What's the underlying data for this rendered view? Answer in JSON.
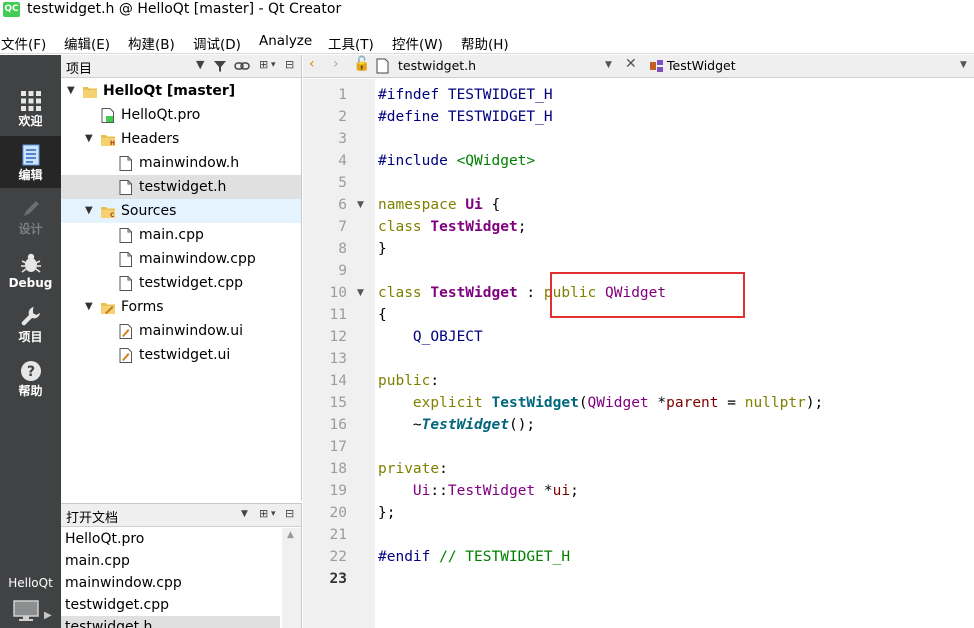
{
  "window": {
    "app_icon_text": "QC",
    "title": "testwidget.h @ HelloQt [master] - Qt Creator"
  },
  "menu": [
    "文件(F)",
    "编辑(E)",
    "构建(B)",
    "调试(D)",
    "Analyze",
    "工具(T)",
    "控件(W)",
    "帮助(H)"
  ],
  "modes": [
    {
      "label": "欢迎",
      "icon": "grid-icon"
    },
    {
      "label": "编辑",
      "icon": "edit-document-icon",
      "active": true
    },
    {
      "label": "设计",
      "icon": "pencil-icon",
      "disabled": true
    },
    {
      "label": "Debug",
      "icon": "bug-icon"
    },
    {
      "label": "项目",
      "icon": "wrench-icon"
    },
    {
      "label": "帮助",
      "icon": "help-icon"
    }
  ],
  "kit": {
    "label": "HelloQt",
    "icon": "monitor-icon"
  },
  "project_pane": {
    "title": "项目",
    "tree": [
      {
        "label": "HelloQt [master]",
        "bold": true,
        "arrow": "▼",
        "icon": "project-folder-icon"
      },
      {
        "label": "HelloQt.pro",
        "icon": "pro-file-icon"
      },
      {
        "label": "Headers",
        "arrow": "▼",
        "icon": "headers-folder-icon"
      },
      {
        "label": "mainwindow.h",
        "icon": "file-icon"
      },
      {
        "label": "testwidget.h",
        "icon": "file-icon",
        "selected": true
      },
      {
        "label": "Sources",
        "arrow": "▼",
        "icon": "sources-folder-icon",
        "hover": true
      },
      {
        "label": "main.cpp",
        "icon": "file-icon"
      },
      {
        "label": "mainwindow.cpp",
        "icon": "file-icon"
      },
      {
        "label": "testwidget.cpp",
        "icon": "file-icon"
      },
      {
        "label": "Forms",
        "arrow": "▼",
        "icon": "forms-folder-icon"
      },
      {
        "label": "mainwindow.ui",
        "icon": "ui-file-icon"
      },
      {
        "label": "testwidget.ui",
        "icon": "ui-file-icon"
      }
    ]
  },
  "docs_pane": {
    "title": "打开文档",
    "items": [
      "HelloQt.pro",
      "main.cpp",
      "mainwindow.cpp",
      "testwidget.cpp",
      "testwidget.h"
    ],
    "selected": "testwidget.h"
  },
  "editor": {
    "file_name": "testwidget.h",
    "symbol": "TestWidget",
    "current_line": 23,
    "fold_lines": [
      6,
      10
    ],
    "highlight_color": "#e03030",
    "lines": [
      [
        [
          "#ifndef TESTWIDGET_H",
          "pp"
        ]
      ],
      [
        [
          "#define TESTWIDGET_H",
          "pp"
        ]
      ],
      [],
      [
        [
          "#include ",
          "pp"
        ],
        [
          "<QWidget>",
          "st"
        ]
      ],
      [],
      [
        [
          "namespace ",
          "kw"
        ],
        [
          "Ui",
          "ty"
        ],
        [
          " {",
          "pl"
        ]
      ],
      [
        [
          "class ",
          "kw"
        ],
        [
          "TestWidget",
          "ty"
        ],
        [
          ";",
          "pl"
        ]
      ],
      [
        [
          "}",
          "pl"
        ]
      ],
      [],
      [
        [
          "class ",
          "kw"
        ],
        [
          "TestWidget",
          "ty"
        ],
        [
          " : ",
          "pl"
        ],
        [
          "public ",
          "kw"
        ],
        [
          "QWidget",
          "cl"
        ]
      ],
      [
        [
          "{",
          "pl"
        ]
      ],
      [
        [
          "    ",
          "pl"
        ],
        [
          "Q_OBJECT",
          "mc"
        ]
      ],
      [],
      [
        [
          "public",
          "kw"
        ],
        [
          ":",
          "pl"
        ]
      ],
      [
        [
          "    ",
          "pl"
        ],
        [
          "explicit ",
          "kw"
        ],
        [
          "TestWidget",
          "fn"
        ],
        [
          "(",
          "pl"
        ],
        [
          "QWidget",
          "cl"
        ],
        [
          " *",
          "pl"
        ],
        [
          "parent",
          "mb"
        ],
        [
          " = ",
          "pl"
        ],
        [
          "nullptr",
          "kw"
        ],
        [
          ");",
          "pl"
        ]
      ],
      [
        [
          "    ~",
          "pl"
        ],
        [
          "TestWidget",
          "fi"
        ],
        [
          "();",
          "pl"
        ]
      ],
      [],
      [
        [
          "private",
          "kw"
        ],
        [
          ":",
          "pl"
        ]
      ],
      [
        [
          "    ",
          "pl"
        ],
        [
          "Ui",
          "cl"
        ],
        [
          "::",
          "pl"
        ],
        [
          "TestWidget",
          "cl"
        ],
        [
          " *",
          "pl"
        ],
        [
          "ui",
          "mb"
        ],
        [
          ";",
          "pl"
        ]
      ],
      [
        [
          "};",
          "pl"
        ]
      ],
      [],
      [
        [
          "#endif ",
          "pp"
        ],
        [
          "// TESTWIDGET_H",
          "cm"
        ]
      ],
      []
    ]
  }
}
